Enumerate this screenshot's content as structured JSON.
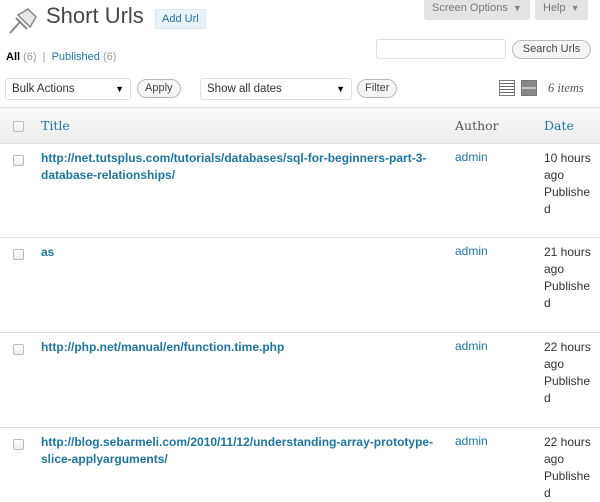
{
  "header": {
    "title": "Short Urls",
    "add_button": "Add Url",
    "screen_options": "Screen Options",
    "help": "Help"
  },
  "filters": {
    "all_label": "All",
    "all_count": "(6)",
    "separator": "|",
    "published_label": "Published",
    "published_count": "(6)"
  },
  "search": {
    "value": "",
    "button": "Search Urls"
  },
  "bulk": {
    "selected": "Bulk Actions",
    "apply": "Apply"
  },
  "dates": {
    "selected": "Show all dates",
    "filter": "Filter"
  },
  "items_count": "6 items",
  "table": {
    "columns": {
      "title": "Title",
      "author": "Author",
      "date": "Date"
    },
    "rows": [
      {
        "title": "http://net.tutsplus.com/tutorials/databases/sql-for-beginners-part-3-database-relationships/",
        "author": "admin",
        "date_ago": "10 hours ago",
        "status": "Published"
      },
      {
        "title": "as",
        "author": "admin",
        "date_ago": "21 hours ago",
        "status": "Published"
      },
      {
        "title": "http://php.net/manual/en/function.time.php",
        "author": "admin",
        "date_ago": "22 hours ago",
        "status": "Published"
      },
      {
        "title": "http://blog.sebarmeli.com/2010/11/12/understanding-array-prototype-slice-applyarguments/",
        "author": "admin",
        "date_ago": "22 hours ago",
        "status": "Published"
      }
    ]
  },
  "icons": {
    "page_icon": "pushpin-icon",
    "list_view": "list-view-icon",
    "excerpt_view": "excerpt-view-icon"
  }
}
